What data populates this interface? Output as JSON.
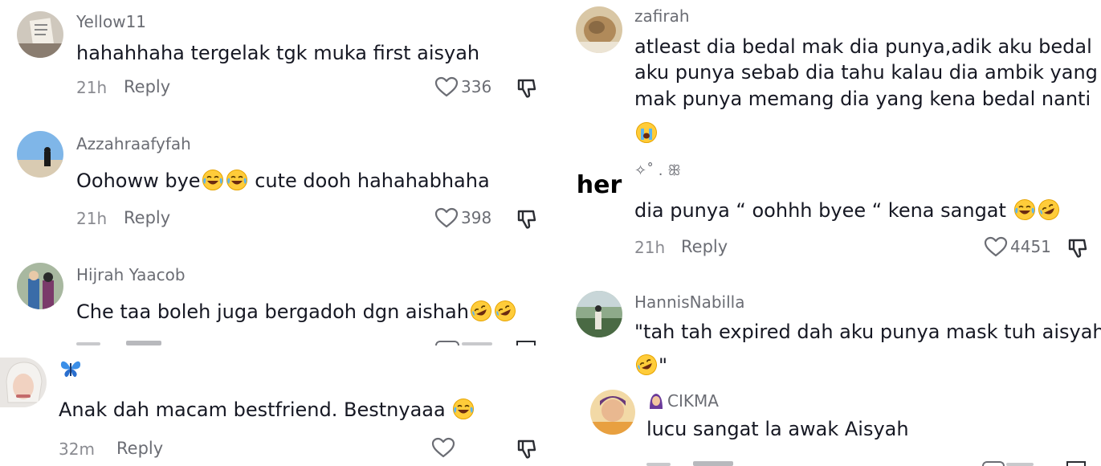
{
  "left_column": {
    "comments": [
      {
        "username": "Yellow11",
        "text": "hahahhaha tergelak tgk muka first aisyah",
        "time": "21h",
        "reply": "Reply",
        "likes": "336"
      },
      {
        "username": "Azzahraafyfah",
        "text_a": "Oohoww bye",
        "text_b": "cute dooh hahahabhaha",
        "time": "21h",
        "reply": "Reply",
        "likes": "398"
      },
      {
        "username": "Hijrah Yaacob",
        "text": "Che taa boleh juga bergadoh dgn aishah",
        "time": "",
        "reply": "",
        "likes": ""
      }
    ]
  },
  "bottom_left": {
    "username_icon": "butterfly-icon",
    "text": "Anak dah macam bestfriend. Bestnyaaa",
    "time": "32m",
    "reply": "Reply"
  },
  "right_column": {
    "comments": [
      {
        "username": "zafirah",
        "lines": [
          "atleast dia bedal mak dia punya,adik aku bedal",
          "aku punya sebab dia tahu kalau dia ambik yang",
          "mak punya memang dia yang kena bedal nanti"
        ]
      },
      {
        "username": "✧˚ . ꕥ",
        "text": "dia punya “ oohhh byee “ kena sangat",
        "time": "21h",
        "reply": "Reply",
        "likes": "4451"
      },
      {
        "username": "HannisNabilla",
        "text": "\"tah tah expired dah aku punya mask tuh aisyah",
        "text_end": "\""
      },
      {
        "username": "CIKMA",
        "text": "lucu sangat la awak Aisyah"
      }
    ]
  },
  "colors": {
    "text": "#161823",
    "muted": "#6b6d74",
    "time": "#8a8b91",
    "emoji": "#ffcc3a"
  }
}
